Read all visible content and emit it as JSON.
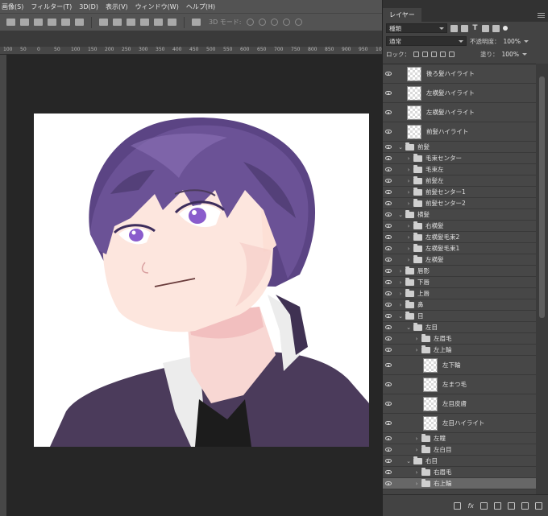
{
  "menu": [
    "画像(S)",
    "フィルター(T)",
    "3D(D)",
    "表示(V)",
    "ウィンドウ(W)",
    "ヘルプ(H)"
  ],
  "options_bar": {
    "mode_label": "3D モード:"
  },
  "ruler_ticks": [
    "100",
    "50",
    "0",
    "50",
    "100",
    "150",
    "200",
    "250",
    "300",
    "350",
    "400",
    "450",
    "500",
    "550",
    "600",
    "650",
    "700",
    "750",
    "800",
    "850",
    "900",
    "950",
    "1000"
  ],
  "panel": {
    "tab": "レイヤー",
    "filter_kind": "種類",
    "blend_mode": "通常",
    "opacity_label": "不透明度：",
    "opacity_value": "100%",
    "lock_label": "ロック：",
    "fill_label": "塗り：",
    "fill_value": "100%"
  },
  "layers": [
    {
      "name": "後ろ髪ハイライト",
      "type": "layer",
      "indent": 0,
      "selected": false
    },
    {
      "name": "左横髪ハイライト",
      "type": "layer",
      "indent": 0,
      "selected": false
    },
    {
      "name": "左横髪ハイライト",
      "type": "layer",
      "indent": 0,
      "selected": false
    },
    {
      "name": "前髪ハイライト",
      "type": "layer",
      "indent": 0,
      "selected": false
    },
    {
      "name": "前髪",
      "type": "group",
      "indent": 0,
      "open": true,
      "selected": false
    },
    {
      "name": "毛束センター",
      "type": "group",
      "indent": 1,
      "open": false,
      "selected": false
    },
    {
      "name": "毛束左",
      "type": "group",
      "indent": 1,
      "open": false,
      "selected": false
    },
    {
      "name": "前髪左",
      "type": "group",
      "indent": 1,
      "open": false,
      "selected": false
    },
    {
      "name": "前髪センター1",
      "type": "group",
      "indent": 1,
      "open": false,
      "selected": false
    },
    {
      "name": "前髪センター2",
      "type": "group",
      "indent": 1,
      "open": false,
      "selected": false
    },
    {
      "name": "横髪",
      "type": "group",
      "indent": 0,
      "open": true,
      "selected": false
    },
    {
      "name": "右横髪",
      "type": "group",
      "indent": 1,
      "open": false,
      "selected": false
    },
    {
      "name": "左横髪毛束2",
      "type": "group",
      "indent": 1,
      "open": false,
      "selected": false
    },
    {
      "name": "左横髪毛束1",
      "type": "group",
      "indent": 1,
      "open": false,
      "selected": false
    },
    {
      "name": "左横髪",
      "type": "group",
      "indent": 1,
      "open": false,
      "selected": false
    },
    {
      "name": "唇影",
      "type": "group",
      "indent": 0,
      "open": false,
      "selected": false
    },
    {
      "name": "下唇",
      "type": "group",
      "indent": 0,
      "open": false,
      "selected": false
    },
    {
      "name": "上唇",
      "type": "group",
      "indent": 0,
      "open": false,
      "selected": false
    },
    {
      "name": "鼻",
      "type": "group",
      "indent": 0,
      "open": false,
      "selected": false
    },
    {
      "name": "目",
      "type": "group",
      "indent": 0,
      "open": true,
      "selected": false
    },
    {
      "name": "左目",
      "type": "group",
      "indent": 1,
      "open": true,
      "selected": false
    },
    {
      "name": "左眉毛",
      "type": "group",
      "indent": 2,
      "open": false,
      "selected": false
    },
    {
      "name": "左上輪",
      "type": "group",
      "indent": 2,
      "open": false,
      "selected": false
    },
    {
      "name": "左下輪",
      "type": "layer",
      "indent": 2,
      "selected": false
    },
    {
      "name": "左まつ毛",
      "type": "layer",
      "indent": 2,
      "selected": false
    },
    {
      "name": "左目皮膚",
      "type": "layer",
      "indent": 2,
      "selected": false
    },
    {
      "name": "左目ハイライト",
      "type": "layer",
      "indent": 2,
      "selected": false
    },
    {
      "name": "左瞳",
      "type": "group",
      "indent": 2,
      "open": false,
      "selected": false
    },
    {
      "name": "左白目",
      "type": "group",
      "indent": 2,
      "open": false,
      "selected": false
    },
    {
      "name": "右目",
      "type": "group",
      "indent": 1,
      "open": true,
      "selected": false
    },
    {
      "name": "右眉毛",
      "type": "group",
      "indent": 2,
      "open": false,
      "selected": false
    },
    {
      "name": "右上輪",
      "type": "group",
      "indent": 2,
      "open": false,
      "selected": true
    }
  ],
  "colors": {
    "hair": "#6b5296",
    "hair_dark": "#3d2d5c",
    "skin": "#fde6de",
    "skin_shadow": "#f2bfbf",
    "eye": "#8a5ccc",
    "jacket": "#4b3b5b",
    "collar_white": "#ececec"
  }
}
